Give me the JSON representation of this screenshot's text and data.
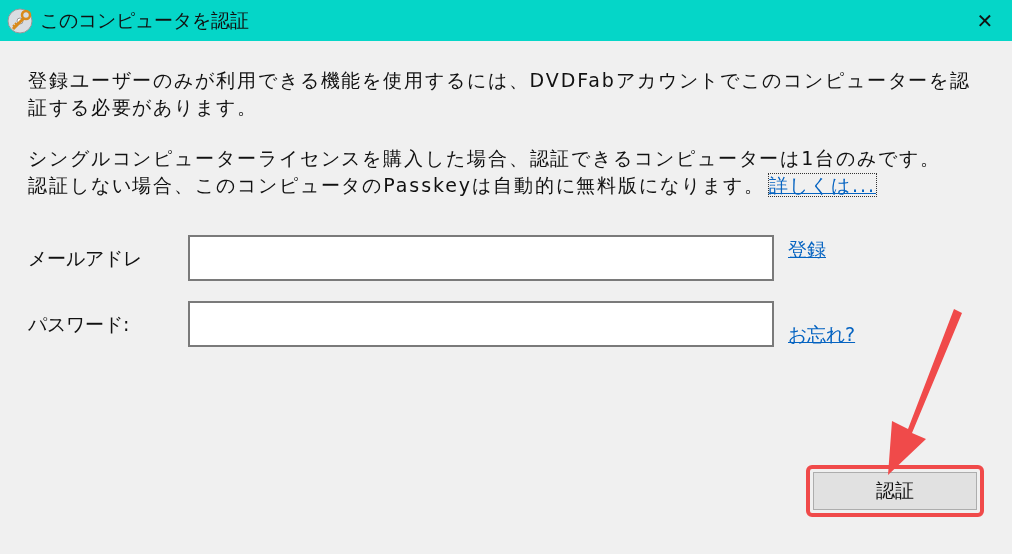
{
  "window": {
    "title": "このコンピュータを認証",
    "close": "✕"
  },
  "paragraphs": [
    {
      "text": "登録ユーザーのみが利用できる機能を使用するには、DVDFabアカウントでこのコンピューターを認証する必要があります。"
    },
    {
      "text": "シングルコンピューターライセンスを購入した場合、認証できるコンピューターは1台のみです。",
      "gap": true
    },
    {
      "text": "認証しない場合、このコンピュータのPasskeyは自動的に無料版になります。",
      "link": "詳しくは..."
    }
  ],
  "fields": [
    {
      "label": "メールアドレ",
      "kind": "email",
      "link": "登録"
    },
    {
      "label": "パスワード:",
      "kind": "password",
      "link": "お忘れ?"
    }
  ],
  "button": {
    "label": "認証",
    "highlighted": true
  }
}
